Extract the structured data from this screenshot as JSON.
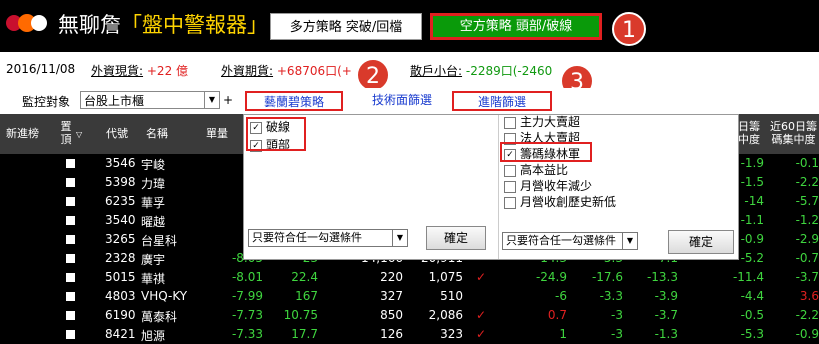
{
  "app": {
    "title_prefix": "無聊詹",
    "title_highlight": "「盤中警報器」"
  },
  "tabs": {
    "multi": "多方策略  突破/回檔",
    "short": "空方策略  頭部/破線"
  },
  "badges": [
    "1",
    "2",
    "3"
  ],
  "info": {
    "date": "2016/11/08",
    "spot_label": "外資現貨:",
    "spot_value": "+22 億",
    "futures_label": "外資期貨:",
    "futures_value": "+68706口(+",
    "retail_label": "散戶小台:",
    "retail_value": "-2289口(-2460"
  },
  "filter": {
    "monitor_label": "監控對象",
    "monitor_value": "台股上市櫃",
    "plus": "+",
    "tabs": [
      "藝蘭碧策略",
      "技術面篩選",
      "進階篩選"
    ]
  },
  "table": {
    "headers": [
      "新進榜",
      "置頂",
      "代號",
      "名稱",
      "單量",
      "日籌\n中度",
      "近60日籌\n碼集中度"
    ],
    "rows": [
      {
        "code": "3546",
        "name": "宇峻",
        "right": [
          {
            "t": "-1.9",
            "c": "#3fd53f"
          },
          {
            "t": "-0.1",
            "c": "#3fd53f"
          }
        ]
      },
      {
        "code": "5398",
        "name": "力瑋",
        "right": [
          {
            "t": "-1.5",
            "c": "#3fd53f"
          },
          {
            "t": "-2.2",
            "c": "#3fd53f"
          }
        ]
      },
      {
        "code": "6235",
        "name": "華孚",
        "right": [
          {
            "t": "-14",
            "c": "#3fd53f"
          },
          {
            "t": "-5.7",
            "c": "#3fd53f"
          }
        ]
      },
      {
        "code": "3540",
        "name": "曜越",
        "right": [
          {
            "t": "-1.1",
            "c": "#3fd53f"
          },
          {
            "t": "-1.2",
            "c": "#3fd53f"
          }
        ]
      },
      {
        "code": "3265",
        "name": "台星科",
        "right": [
          {
            "t": "-0.9",
            "c": "#3fd53f"
          },
          {
            "t": "-2.9",
            "c": "#3fd53f"
          }
        ]
      },
      {
        "code": "2328",
        "name": "廣宇",
        "c1": "-8.05",
        "c2": "23",
        "c3": "14,166",
        "c4": "20,911",
        "c6": "-14.3",
        "c7": "-5.3",
        "c8": "-7.1",
        "right": [
          {
            "t": "-5.2",
            "c": "#3fd53f"
          },
          {
            "t": "-0.7",
            "c": "#3fd53f"
          }
        ]
      },
      {
        "code": "5015",
        "name": "華祺",
        "c1": "-8.01",
        "c2": "22.4",
        "c3": "220",
        "c4": "1,075",
        "tick": "✓",
        "c6": "-24.9",
        "c7": "-17.6",
        "c8": "-13.3",
        "right": [
          {
            "t": "-11.4",
            "c": "#3fd53f"
          },
          {
            "t": "-3.7",
            "c": "#3fd53f"
          }
        ]
      },
      {
        "code": "4803",
        "name": "VHQ-KY",
        "c1": "-7.99",
        "c2": "167",
        "c3": "327",
        "c4": "510",
        "c6": "-6",
        "c7": "-3.3",
        "c8": "-3.9",
        "right": [
          {
            "t": "-4.4",
            "c": "#3fd53f"
          },
          {
            "t": "3.6",
            "c": "#e02020"
          }
        ]
      },
      {
        "code": "6190",
        "name": "萬泰科",
        "c1": "-7.73",
        "c2": "10.75",
        "c3": "850",
        "c4": "2,086",
        "tick": "✓",
        "c6": "0.7",
        "c6c": "#e02020",
        "c7": "-3",
        "c8": "-3.7",
        "right": [
          {
            "t": "-0.5",
            "c": "#3fd53f"
          },
          {
            "t": "-2.2",
            "c": "#3fd53f"
          }
        ]
      },
      {
        "code": "8421",
        "name": "旭源",
        "c1": "-7.33",
        "c2": "17.7",
        "c3": "126",
        "c4": "323",
        "tick": "✓",
        "c6": "1",
        "c7": "-3",
        "c8": "-1.3",
        "right": [
          {
            "t": "-5.3",
            "c": "#3fd53f"
          },
          {
            "t": "-0.9",
            "c": "#3fd53f"
          }
        ]
      }
    ]
  },
  "panel": {
    "left_options": [
      {
        "label": "破線",
        "checked": true
      },
      {
        "label": "頭部",
        "checked": true
      }
    ],
    "right_options": [
      {
        "label": "主力大賣超",
        "checked": false
      },
      {
        "label": "法人大賣超",
        "checked": false
      },
      {
        "label": "籌碼綠林軍",
        "checked": true
      },
      {
        "label": "高本益比",
        "checked": false
      },
      {
        "label": "月營收年減少",
        "checked": false
      },
      {
        "label": "月營收創歷史新低",
        "checked": false
      }
    ],
    "left_select": "只要符合任一勾選條件",
    "right_select": "只要符合任一勾選條件",
    "confirm": "確定"
  }
}
